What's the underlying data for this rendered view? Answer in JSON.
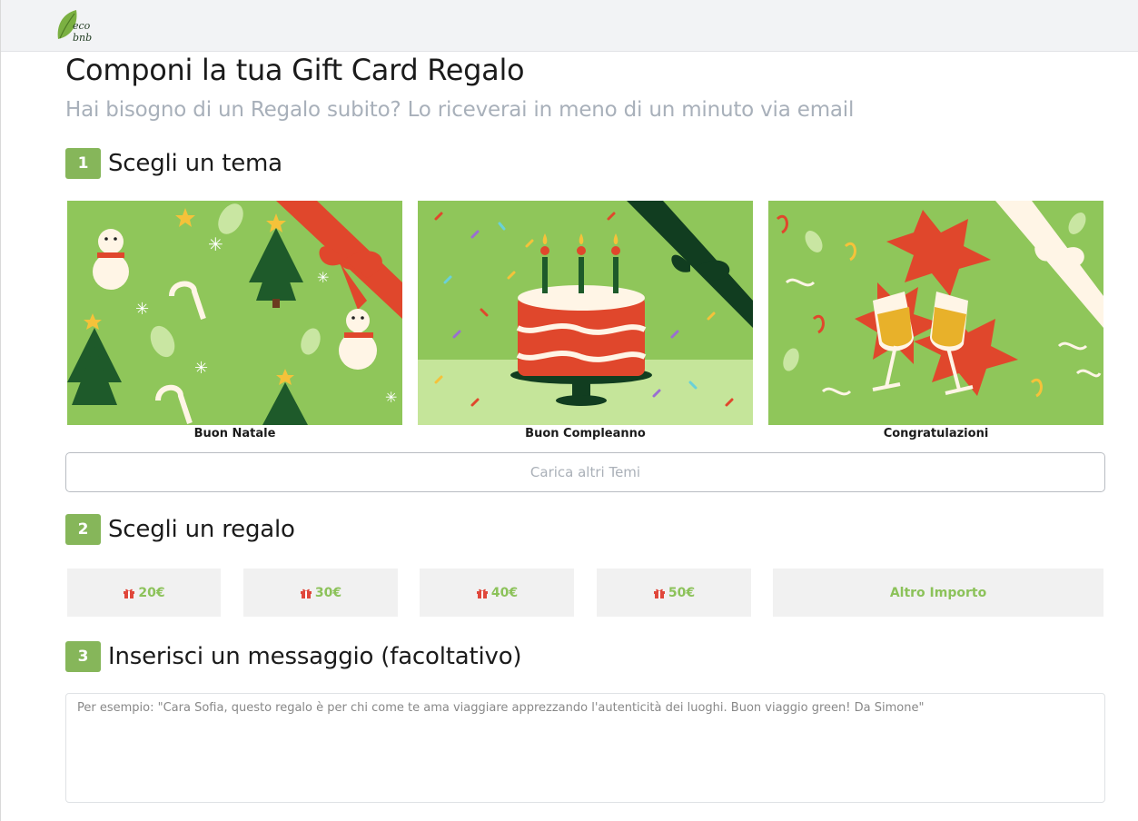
{
  "header": {
    "logo_text": "eco bnb"
  },
  "page": {
    "title": "Componi la tua Gift Card Regalo",
    "subtitle": "Hai bisogno di un Regalo subito? Lo riceverai in meno di un minuto via email"
  },
  "steps": [
    {
      "number": "1",
      "label": "Scegli un tema"
    },
    {
      "number": "2",
      "label": "Scegli un regalo"
    },
    {
      "number": "3",
      "label": "Inserisci un messaggio (facoltativo)"
    }
  ],
  "themes": [
    {
      "label": "Buon Natale"
    },
    {
      "label": "Buon Compleanno"
    },
    {
      "label": "Congratulazioni"
    }
  ],
  "load_more_label": "Carica altri Temi",
  "amounts": [
    {
      "label": "20€"
    },
    {
      "label": "30€"
    },
    {
      "label": "40€"
    },
    {
      "label": "50€"
    }
  ],
  "other_amount_label": "Altro Importo",
  "message": {
    "placeholder": "Per esempio: \"Cara Sofia, questo regalo è per chi come te ama viaggiare apprezzando l'autenticità dei luoghi. Buon viaggio green! Da Simone\""
  },
  "colors": {
    "accent_green": "#86b65a",
    "amount_text": "#8cc25a",
    "gift_icon": "#e0473b",
    "card_green": "#8fc65a"
  }
}
